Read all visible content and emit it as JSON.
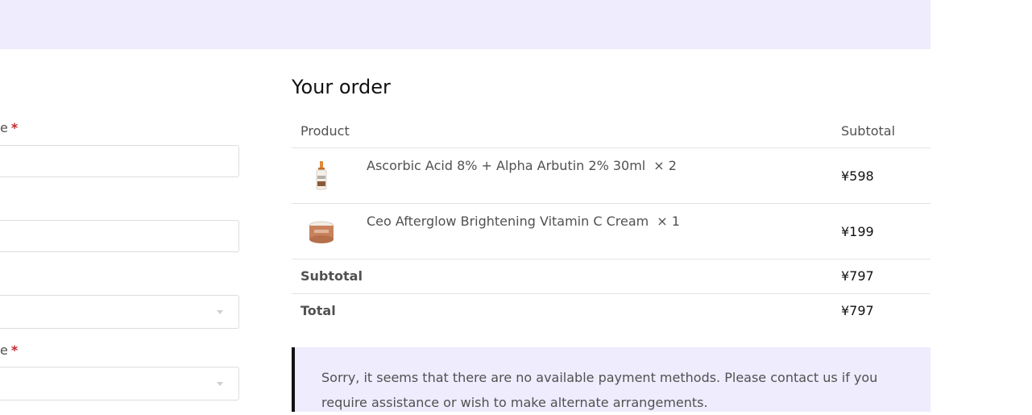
{
  "form": {
    "fields": [
      {
        "label_fragment": "e",
        "required": "*"
      },
      {
        "label_fragment": "e",
        "required": "*"
      }
    ]
  },
  "order": {
    "heading": "Your order",
    "columns": {
      "product": "Product",
      "subtotal": "Subtotal"
    },
    "items": [
      {
        "name": "Ascorbic Acid 8% + Alpha Arbutin 2% 30ml",
        "qty": "× 2",
        "price": "¥598",
        "thumb_icon": "serum-bottle-thumbnail"
      },
      {
        "name": "Ceo Afterglow Brightening Vitamin C Cream",
        "qty": "× 1",
        "price": "¥199",
        "thumb_icon": "cream-jar-thumbnail"
      }
    ],
    "subtotal": {
      "label": "Subtotal",
      "value": "¥797"
    },
    "total": {
      "label": "Total",
      "value": "¥797"
    }
  },
  "notice": {
    "text": "Sorry, it seems that there are no available payment methods. Please contact us if you require assistance or wish to make alternate arrangements."
  },
  "colors": {
    "band": "#eeecfd",
    "required": "#c0282d",
    "notice_border": "#111111"
  }
}
